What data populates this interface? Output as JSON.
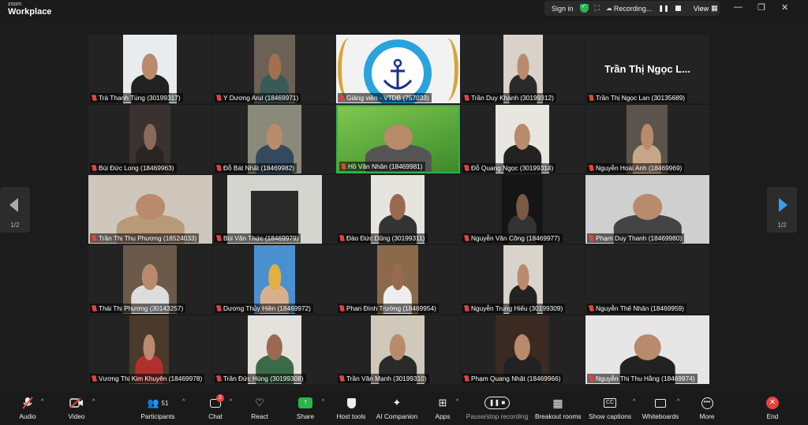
{
  "app": {
    "logo_small": "zoom",
    "logo_big": "Workplace"
  },
  "topbar": {
    "signin": "Sign in",
    "recording": "Recording...",
    "view": "View"
  },
  "pagination": {
    "left": "1/2",
    "right": "1/2"
  },
  "participants": [
    "Trà Thanh Tùng (30199317)",
    "Y Dương Arul (18469971)",
    "Giảng viên - VTDB (757033)",
    "Trần Duy Khánh (30199312)",
    "Trần Thị Ngọc Lan (30135689)",
    "Bùi Đức Long (18469963)",
    "Đỗ Bát Nhất (18469982)",
    "Hồ Văn Nhân (18469981)",
    "Đỗ Quang Ngọc (30199314)",
    "Nguyễn Hoài Anh (18469969)",
    "Trần Thị Thu Phương (18524033)",
    "Bùi Văn Thức (18469979)",
    "Đào Đức Dũng (30199311)",
    "Nguyễn Văn Công (18469977)",
    "Phạm Duy Thanh (18469980)",
    "Thái Thị Phương (30143257)",
    "Dương Thủy Hiền (18469972)",
    "Phan Đình Trường (18469954)",
    "Nguyễn Trung Hiếu (30199309)",
    "Nguyễn Thế Nhân (18469959)",
    "Vương Thị Kim Khuyên (18469978)",
    "Trần Đức Hùng (30199308)",
    "Trần Văn Mạnh (30199310)",
    "Phạm Quang Nhật (18469966)",
    "Nguyễn Thị Thu Hằng (18469974)"
  ],
  "no_video_name": "Trần Thị Ngọc L...",
  "toolbar": {
    "audio": "Audio",
    "video": "Video",
    "participants": "Participants",
    "participants_count": "51",
    "chat": "Chat",
    "chat_badge": "2",
    "react": "React",
    "share": "Share",
    "host_tools": "Host tools",
    "ai_companion": "AI Companion",
    "apps": "Apps",
    "pause_stop": "Pause/stop recording",
    "breakout": "Breakout rooms",
    "captions": "Show captions",
    "whiteboards": "Whiteboards",
    "more": "More",
    "end": "End"
  },
  "colors": {
    "accent": "#0e72ed",
    "record": "#e0443e",
    "shield": "#2db34a",
    "share": "#2db34a"
  }
}
